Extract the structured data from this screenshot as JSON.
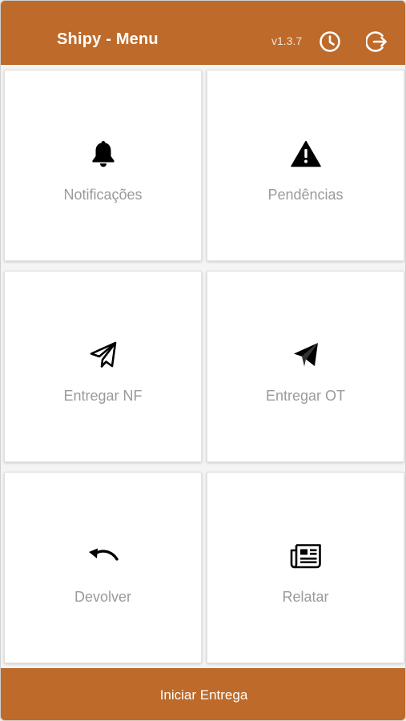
{
  "header": {
    "title": "Shipy - Menu",
    "version": "v1.3.7",
    "history_icon": "clock-icon",
    "logout_icon": "sign-out-icon"
  },
  "menu": {
    "items": [
      {
        "label": "Notificações",
        "icon": "bell-icon"
      },
      {
        "label": "Pendências",
        "icon": "warning-icon"
      },
      {
        "label": "Entregar NF",
        "icon": "paper-plane-outline-icon"
      },
      {
        "label": "Entregar OT",
        "icon": "paper-plane-filled-icon"
      },
      {
        "label": "Devolver",
        "icon": "undo-arrow-icon"
      },
      {
        "label": "Relatar",
        "icon": "newspaper-icon"
      }
    ]
  },
  "footer": {
    "button_label": "Iniciar Entrega"
  },
  "colors": {
    "brand": "#bd6a2a",
    "tile_label": "#9a9a9a",
    "background": "#f4f4f4"
  }
}
